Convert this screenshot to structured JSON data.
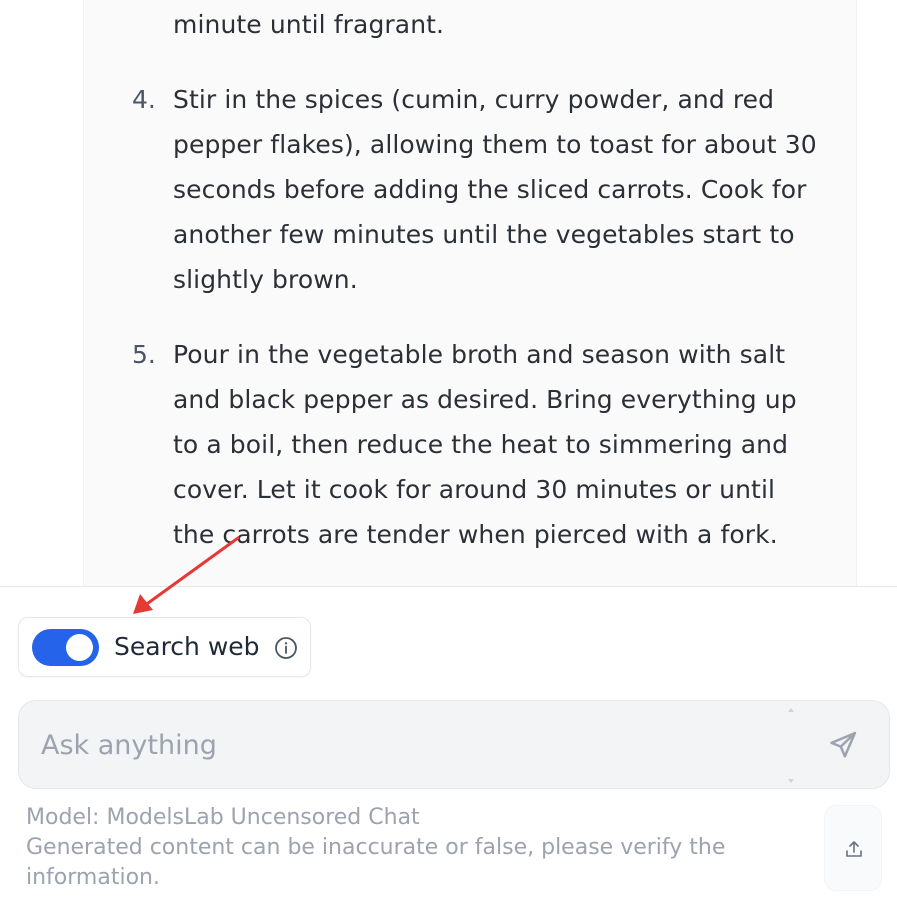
{
  "message": {
    "step3_tail": "minute until fragrant.",
    "steps": [
      {
        "number": "4.",
        "lines": [
          "Stir in the spices (cumin, curry powder, and red",
          "pepper flakes), allowing them to toast for about 30",
          "seconds before adding the sliced carrots. Cook for",
          "another few minutes until the vegetables start to",
          "slightly brown."
        ]
      },
      {
        "number": "5.",
        "lines": [
          "Pour in the vegetable broth and season with salt",
          "and black pepper as desired. Bring everything up",
          "to a boil, then reduce the heat to simmering and",
          "cover. Let it cook for around 30 minutes or until",
          "the carrots are tender when pierced with a fork."
        ]
      }
    ]
  },
  "search_web": {
    "label": "Search web",
    "enabled": true,
    "toggle_color": "#2563eb",
    "info_icon": "info-icon"
  },
  "composer": {
    "placeholder": "Ask anything",
    "value": "",
    "send_icon": "send-icon"
  },
  "footer": {
    "model_line": "Model: ModelsLab Uncensored Chat",
    "disclaimer": "Generated content can be inaccurate or false, please verify the information.",
    "upload_icon": "upload-icon"
  },
  "annotation": {
    "arrow_color": "#e53935"
  }
}
